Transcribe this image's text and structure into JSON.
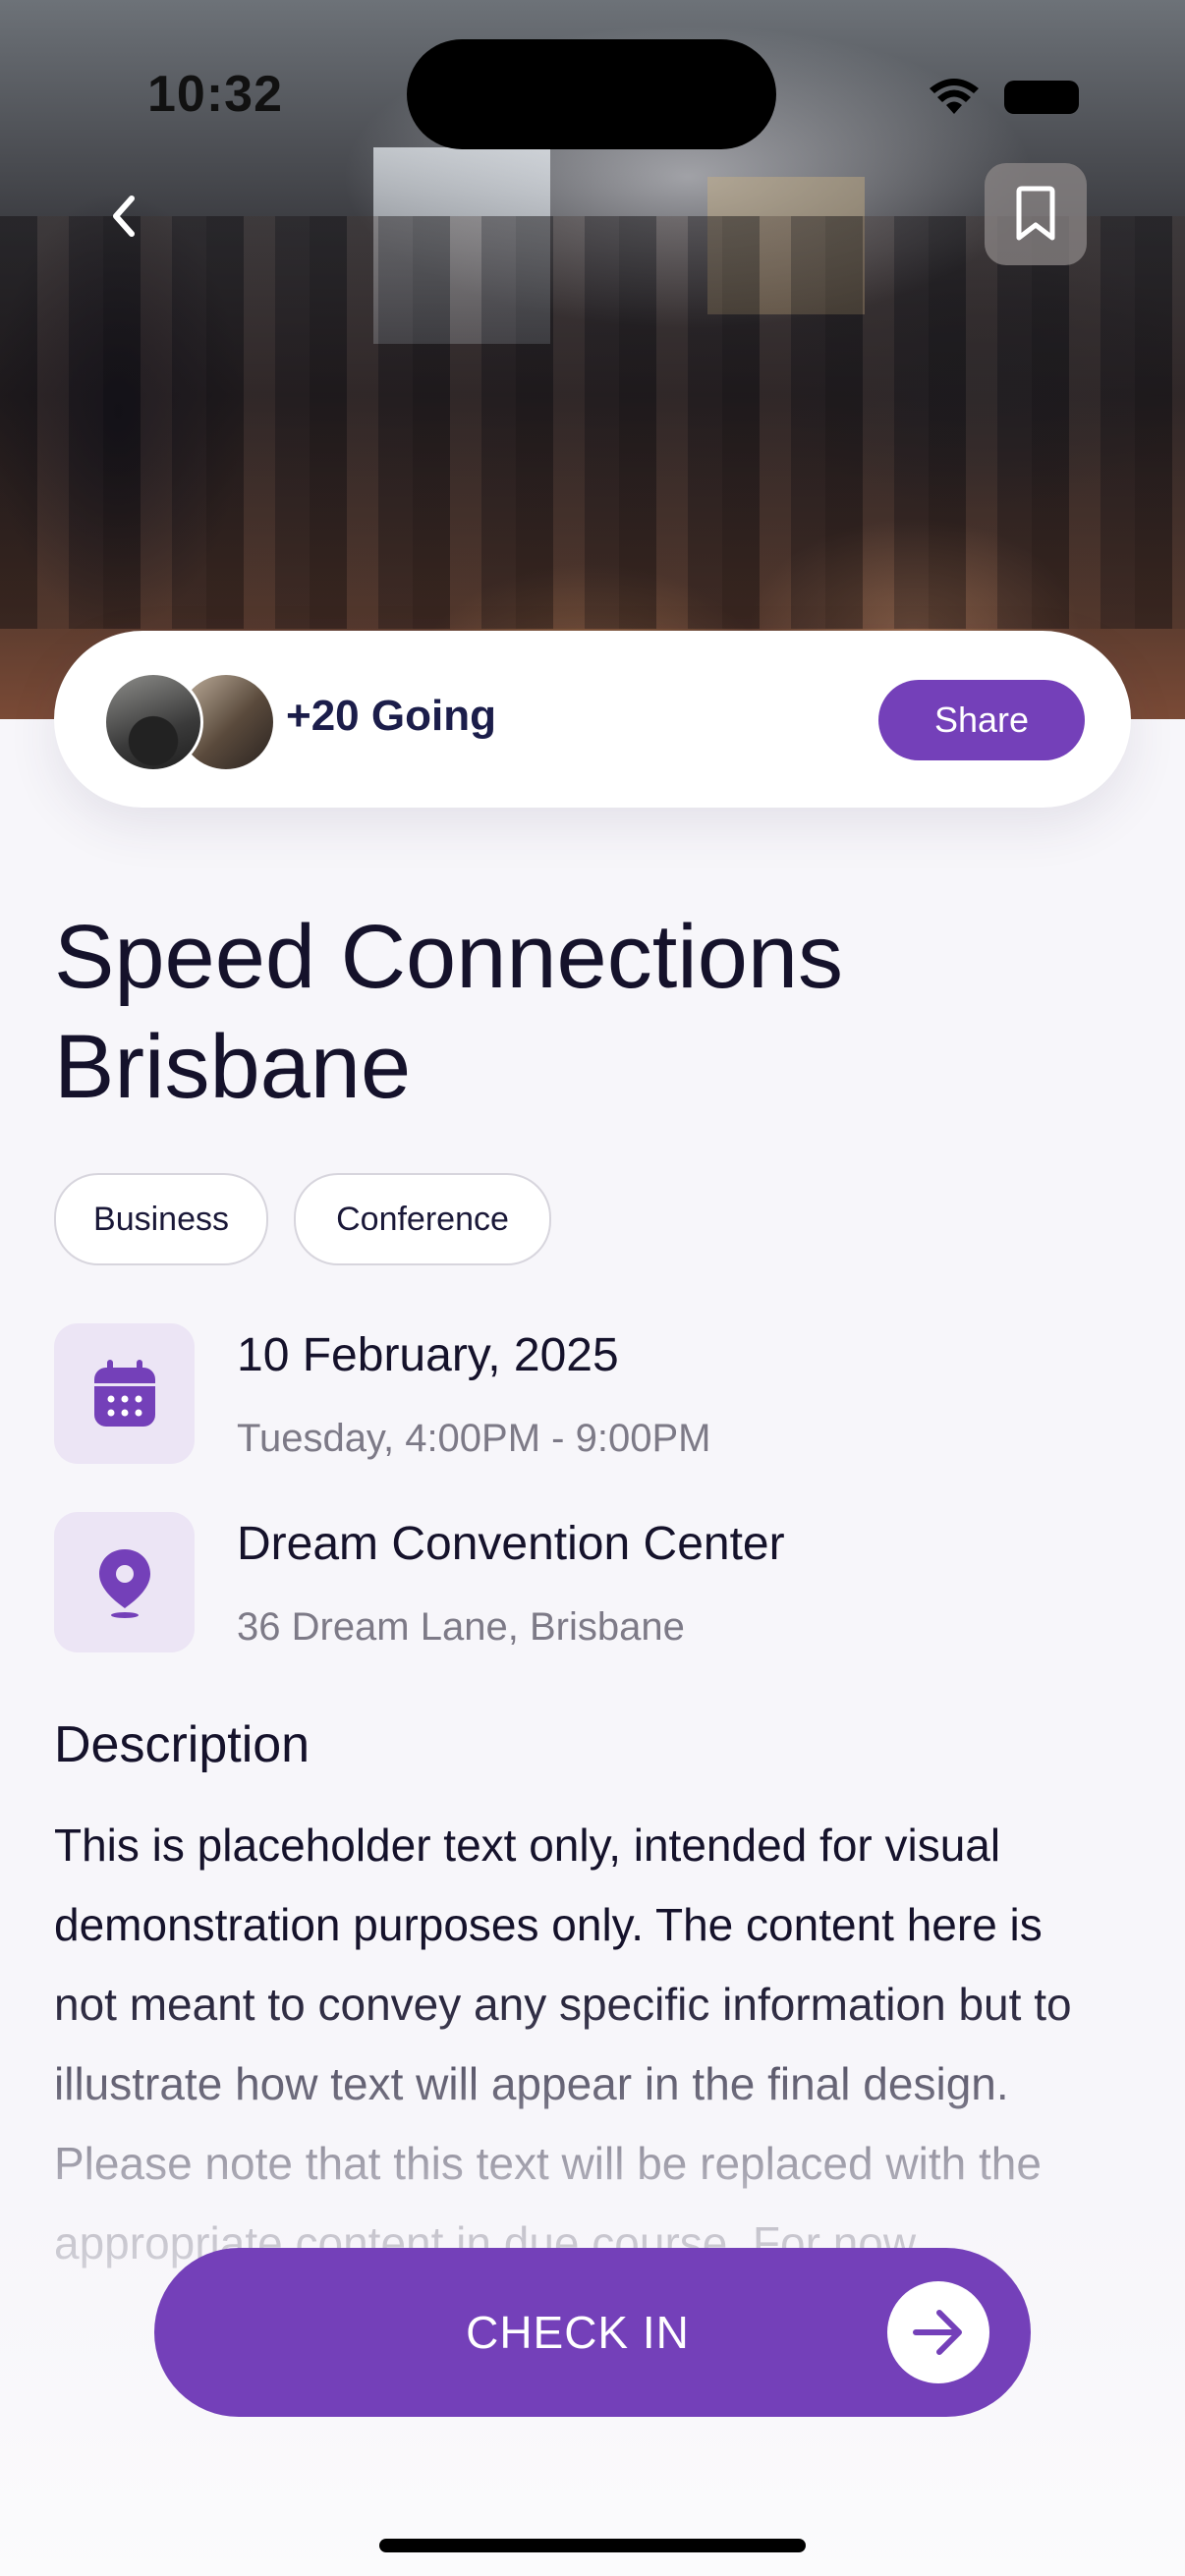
{
  "status_bar": {
    "time": "10:32"
  },
  "event": {
    "attendees_text": "+20 Going",
    "share_label": "Share",
    "title_line1": "Speed Connections",
    "title_line2": "Brisbane",
    "tags": [
      "Business",
      "Conference"
    ],
    "date": "10 February, 2025",
    "time_range": "Tuesday, 4:00PM - 9:00PM",
    "venue": "Dream Convention Center",
    "address": "36 Dream Lane, Brisbane",
    "description_heading": "Description",
    "description": "This is placeholder text only, intended for visual demonstration purposes only. The content here is not meant to convey any specific information but to illustrate how text will appear in the final design. Please note that this text will be replaced with the appropriate content in due course. For now,"
  },
  "actions": {
    "check_in_label": "CHECK IN"
  },
  "icons": {
    "back": "chevron-left-icon",
    "bookmark": "bookmark-icon",
    "calendar": "calendar-icon",
    "location": "map-pin-icon",
    "arrow": "arrow-right-icon"
  },
  "colors": {
    "accent": "#7440b9",
    "icon_bg": "#ece5f5",
    "text_primary": "#15122b",
    "text_secondary": "#7d7a87"
  }
}
